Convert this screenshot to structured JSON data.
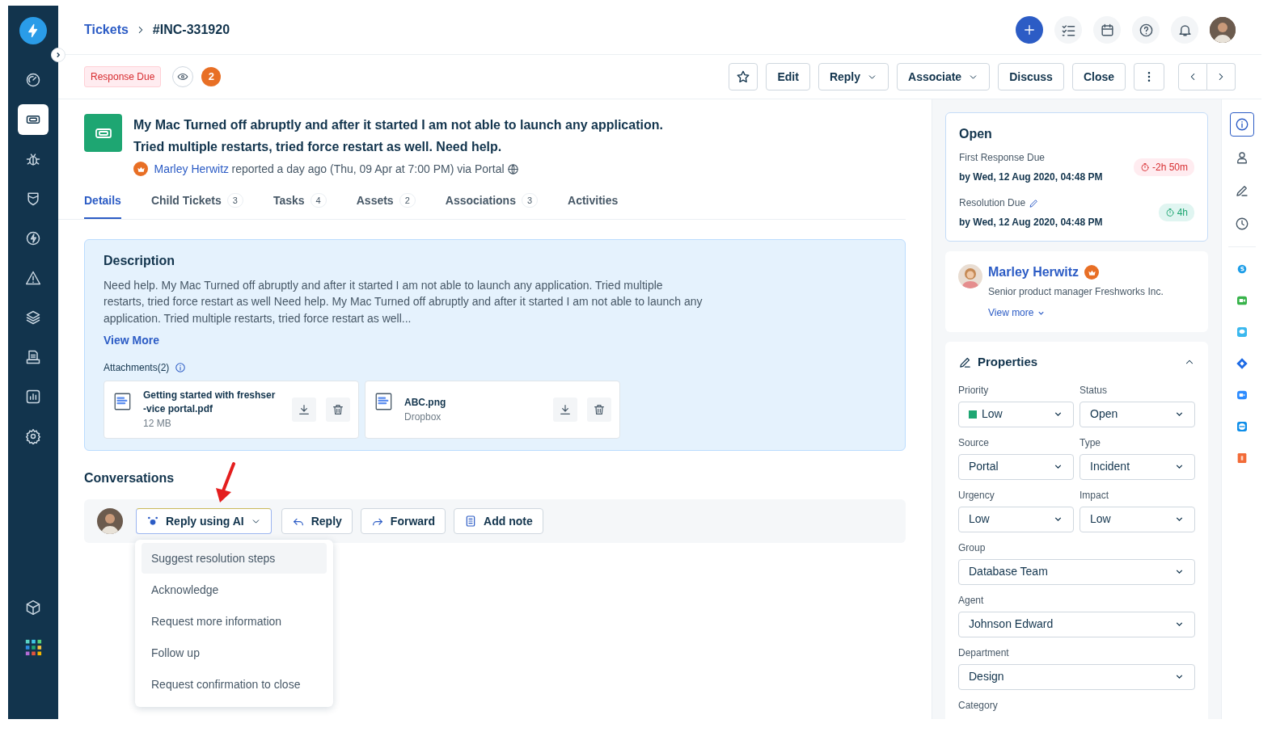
{
  "sidebar": {
    "items": [
      {
        "selected": false
      },
      {
        "selected": true
      },
      {
        "selected": false
      },
      {
        "selected": false
      },
      {
        "selected": false
      },
      {
        "selected": false
      },
      {
        "selected": false
      },
      {
        "selected": false
      },
      {
        "selected": false
      },
      {
        "selected": false
      }
    ]
  },
  "panel_tabs": [
    {
      "selected": true
    },
    {
      "selected": false
    },
    {
      "selected": false
    },
    {
      "selected": false
    }
  ],
  "breadcrumb": [
    {
      "label": "Tickets",
      "kind": "link"
    },
    {
      "label": "#INC-331920",
      "kind": "current"
    }
  ],
  "status_tag": "Response Due",
  "watcher_count": "2",
  "toolbar": [
    {
      "label": "Edit",
      "dropdown": false
    },
    {
      "label": "Reply",
      "dropdown": true
    },
    {
      "label": "Associate",
      "dropdown": true
    },
    {
      "label": "Discuss",
      "dropdown": false
    },
    {
      "label": "Close",
      "dropdown": false
    }
  ],
  "ticket": {
    "title_lines": [
      "My Mac Turned off abruptly and after it started I am not able to launch any application.",
      "Tried multiple restarts, tried force restart as well. Need help."
    ],
    "requester": "Marley Herwitz",
    "meta": "reported a day ago (Thu, 09 Apr at 7:00 PM) via Portal"
  },
  "tabs": [
    {
      "label": "Details",
      "selected": true
    },
    {
      "label": "Child Tickets",
      "count": "3",
      "selected": false
    },
    {
      "label": "Tasks",
      "count": "4",
      "selected": false
    },
    {
      "label": "Assets",
      "count": "2",
      "selected": false
    },
    {
      "label": "Associations",
      "count": "3",
      "selected": false
    },
    {
      "label": "Activities",
      "selected": false
    }
  ],
  "description": {
    "heading": "Description",
    "lines": [
      "Need help. My Mac Turned off abruptly and after it started I am not able to launch any application. Tried multiple",
      "restarts, tried force restart as well Need help. My Mac Turned off abruptly and after it started I am not able to launch any",
      "application. Tried multiple restarts, tried force restart as well..."
    ],
    "view_more": "View More",
    "attachments_label": "Attachments(2)",
    "attachments": [
      {
        "name_lines": [
          "Getting started with freshser",
          "-vice portal.pdf"
        ],
        "detail": "12 MB"
      },
      {
        "name_lines": [
          "ABC.png"
        ],
        "detail": "Dropbox"
      }
    ]
  },
  "conversations": {
    "heading": "Conversations",
    "actions": [
      {
        "label": "Reply using AI",
        "kind": "ai"
      },
      {
        "label": "Reply",
        "kind": "reply"
      },
      {
        "label": "Forward",
        "kind": "forward"
      },
      {
        "label": "Add note",
        "kind": "note"
      }
    ],
    "menu": [
      {
        "label": "Suggest resolution steps",
        "selected": true
      },
      {
        "label": "Acknowledge",
        "selected": false
      },
      {
        "label": "Request more information",
        "selected": false
      },
      {
        "label": "Follow up",
        "selected": false
      },
      {
        "label": "Request confirmation to close",
        "selected": false
      }
    ]
  },
  "sla": {
    "status": "Open",
    "items": [
      {
        "label": "First Response Due",
        "due": "by Wed, 12 Aug 2020, 04:48 PM",
        "timer": "-2h 50m",
        "overdue": true,
        "editable": false
      },
      {
        "label": "Resolution Due",
        "due": "by Wed, 12 Aug 2020, 04:48 PM",
        "timer": "4h",
        "overdue": false,
        "editable": true
      }
    ]
  },
  "contact": {
    "name": "Marley Herwitz",
    "title": "Senior product manager Freshworks Inc.",
    "view_more": "View more"
  },
  "properties": {
    "heading": "Properties",
    "expanded": true,
    "rows": [
      [
        {
          "label": "Priority",
          "value": "Low",
          "color": "#1ea672"
        },
        {
          "label": "Status",
          "value": "Open"
        }
      ],
      [
        {
          "label": "Source",
          "value": "Portal"
        },
        {
          "label": "Type",
          "value": "Incident"
        }
      ],
      [
        {
          "label": "Urgency",
          "value": "Low"
        },
        {
          "label": "Impact",
          "value": "Low"
        }
      ],
      [
        {
          "label": "Group",
          "value": "Database Team"
        }
      ],
      [
        {
          "label": "Agent",
          "value": "Johnson Edward"
        }
      ],
      [
        {
          "label": "Department",
          "value": "Design"
        }
      ],
      [
        {
          "label": "Category"
        }
      ]
    ]
  }
}
